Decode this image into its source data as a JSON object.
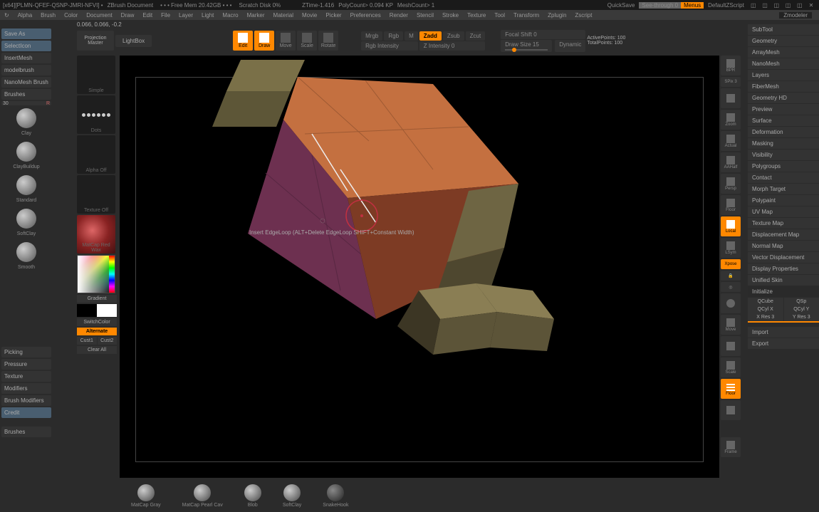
{
  "titlebar": {
    "prefix": "[x64][PLMN-QFEF-QSNP-JMRI-NFVI] •",
    "doc": "ZBrush Document",
    "mem": "• • • Free Mem 20.42GB • • •",
    "ztime": "ZTime-1.416",
    "scratch": "Scratch Disk 0%",
    "polycount": "PolyCount> 0.094 KP",
    "meshcount": "MeshCount> 1",
    "quicksave": "QuickSave",
    "seethrough": "See-through  0",
    "menus": "Menus",
    "script": "DefaultZScript"
  },
  "menubar": [
    "Alpha",
    "Brush",
    "Color",
    "Document",
    "Draw",
    "Edit",
    "File",
    "Layer",
    "Light",
    "Macro",
    "Marker",
    "Material",
    "Movie",
    "Picker",
    "Preferences",
    "Render",
    "Stencil",
    "Stroke",
    "Texture",
    "Tool",
    "Transform",
    "Zplugin",
    "Zscript"
  ],
  "submenu": "Zmodeler",
  "coords": "0.066, 0.066, -0.2",
  "toolbar": {
    "proj": "Projection\nMaster",
    "lightbox": "LightBox",
    "edit": "Edit",
    "draw": "Draw",
    "move": "Move",
    "scale": "Scale",
    "rotate": "Rotate",
    "mrgb": "Mrgb",
    "rgb": "Rgb",
    "m": "M",
    "rgbIntensity": "Rgb Intensity",
    "zadd": "Zadd",
    "zsub": "Zsub",
    "zcut": "Zcut",
    "zintensity": "Z Intensity 0",
    "focal": "Focal Shift 0",
    "drawsize": "Draw Size 15",
    "dynamic": "Dynamic",
    "active": "ActivePoints: 100",
    "total": "TotalPoints: 100"
  },
  "leftPanel": {
    "save": "Save As",
    "select": "SelectIcon",
    "insert": "InsertMesh",
    "model": "modelbrush",
    "nano": "NanoMesh Brush",
    "brushes": "Brushes",
    "b30": "30",
    "brushNames": [
      "Clay",
      "ClayBuildup",
      "Standard",
      "SoftClay",
      "Smooth"
    ],
    "picking": "Picking",
    "pressure": "Pressure",
    "texture": "Texture",
    "modifiers": "Modifiers",
    "brushMod": "Brush Modifiers",
    "credit": "Credit",
    "store": "Brushes"
  },
  "midPanel": {
    "simple": "Simple",
    "dots": "Dots",
    "alphaOff": "Alpha Off",
    "textureOff": "Texture Off",
    "matcap": "MatCap Red Wax",
    "gradient": "Gradient",
    "switch": "SwitchColor",
    "alternate": "Alternate",
    "cust1": "Cust1",
    "cust2": "Cust2",
    "clearAll": "Clear All"
  },
  "canvas": {
    "hint": "Insert EdgeLoop (ALT+Delete EdgeLoop SHIFT+Constant Width)"
  },
  "rightIcons": [
    "BPR",
    "SPix 3",
    "",
    "Zoom",
    "Actual",
    "AAHalf",
    "Persp",
    "Floor",
    "Local",
    "LSym",
    "Xpose",
    "",
    "",
    "",
    "Move",
    "",
    "Scale",
    "",
    "Floor",
    "",
    "",
    "Frame"
  ],
  "rightPanel": {
    "items": [
      "SubTool",
      "Geometry",
      "ArrayMesh",
      "NanoMesh",
      "Layers",
      "FiberMesh",
      "Geometry HD",
      "Preview",
      "Surface",
      "Deformation",
      "Masking",
      "Visibility",
      "Polygroups",
      "Contact",
      "Morph Target",
      "Polypaint",
      "UV Map",
      "Texture Map",
      "Displacement Map",
      "Normal Map",
      "Vector Displacement",
      "Display Properties",
      "Unified Skin",
      "Initialize"
    ],
    "qcube": "QCube",
    "qsphere": "QSp",
    "qcyl_x": "QCyl X",
    "qcyl_y": "QCyl Y",
    "xres": "X Res 3",
    "yres": "Y Res 3",
    "import": "Import",
    "export": "Export"
  },
  "dock": [
    "MatCap Gray",
    "MatCap Pearl Cav",
    "Blob",
    "SoftClay",
    "SnakeHook"
  ]
}
